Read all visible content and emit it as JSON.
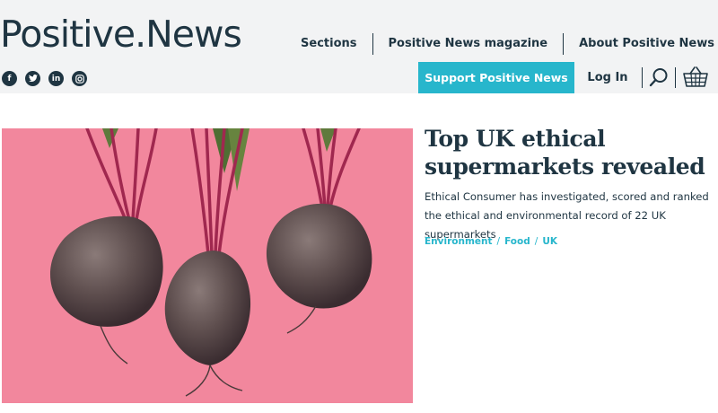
{
  "site": {
    "logo_main": "Positive",
    "logo_dot": ".",
    "logo_second": "News"
  },
  "nav": {
    "items": [
      "Sections",
      "Positive News magazine",
      "About Positive News"
    ]
  },
  "social": [
    {
      "icon": "facebook-icon",
      "glyph": "f"
    },
    {
      "icon": "twitter-icon",
      "glyph": "t"
    },
    {
      "icon": "linkedin-icon",
      "glyph": "in"
    },
    {
      "icon": "instagram-icon",
      "glyph": "◎"
    }
  ],
  "actions": {
    "support_label": "Support Positive News",
    "login_label": "Log In",
    "search_icon": "search-icon",
    "basket_icon": "basket-icon"
  },
  "article": {
    "title": "Top UK ethical supermarkets revealed",
    "summary": "Ethical Consumer has investigated, scored and ranked the ethical and environmental record of 22 UK supermarkets",
    "tags": [
      "Environment",
      "Food",
      "UK"
    ],
    "tag_separator": "/",
    "image_subject": "three beetroots on pink background"
  },
  "colors": {
    "brand_dark": "#1f3542",
    "accent": "#27b6cc",
    "topbar_bg": "#f2f3f4",
    "hero_bg": "#f2879d"
  }
}
